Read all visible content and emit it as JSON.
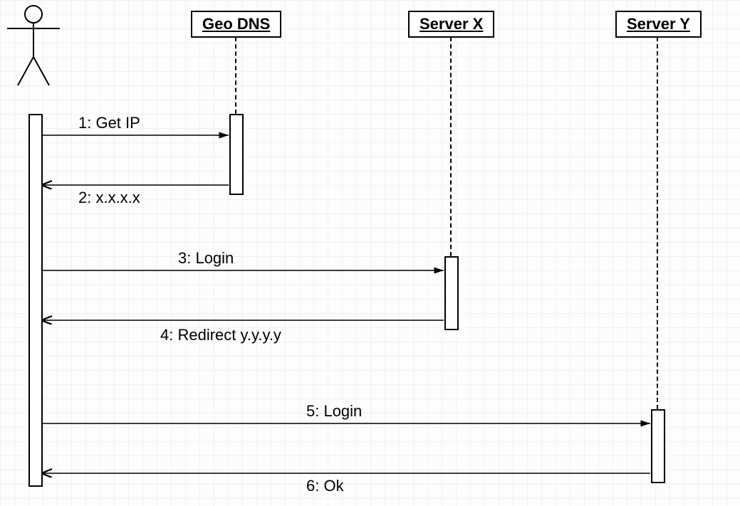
{
  "participants": {
    "actor": "",
    "geo_dns": "Geo DNS",
    "server_x": "Server X",
    "server_y": "Server Y"
  },
  "messages": {
    "m1": "1: Get IP",
    "m2": "2: x.x.x.x",
    "m3": "3: Login",
    "m4": "4: Redirect y.y.y.y",
    "m5": "5: Login",
    "m6": "6: Ok"
  }
}
